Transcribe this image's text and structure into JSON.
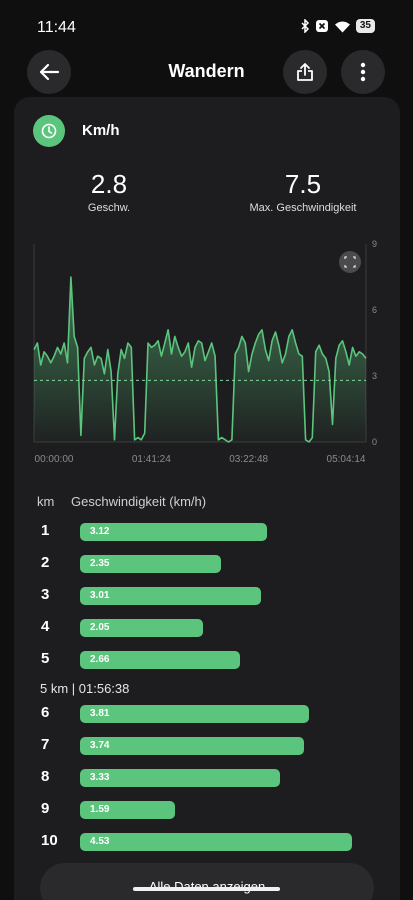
{
  "status": {
    "time": "11:44",
    "battery": "35"
  },
  "header": {
    "title": "Wandern"
  },
  "card": {
    "unit_label": "Km/h",
    "stats": {
      "avg_value": "2.8",
      "avg_label": "Geschw.",
      "max_value": "7.5",
      "max_label": "Max. Geschwindigkeit"
    }
  },
  "chart_data": {
    "type": "area",
    "title": "",
    "xlabel": "",
    "ylabel": "",
    "x_ticks": [
      "00:00:00",
      "01:41:24",
      "03:22:48",
      "05:04:14"
    ],
    "y_ticks": [
      "0",
      "3",
      "6",
      "9"
    ],
    "ylim": [
      0,
      9
    ],
    "average_line": 2.8,
    "series": [
      {
        "values": [
          4.2,
          4.5,
          3.5,
          4.1,
          3.9,
          3.6,
          3.9,
          4.3,
          4.0,
          4.5,
          3.6,
          7.5,
          4.8,
          4.3,
          0.3,
          3.8,
          4.1,
          4.3,
          3.5,
          3.9,
          3.8,
          3.1,
          4.2,
          3.2,
          0.1,
          3.1,
          4.2,
          3.8,
          4.5,
          4.3,
          0.1,
          0.2,
          0.1,
          0.4,
          4.5,
          4.3,
          4.4,
          4.6,
          3.9,
          4.5,
          5.1,
          4.0,
          4.8,
          4.3,
          3.9,
          4.1,
          4.5,
          3.4,
          4.3,
          4.6,
          4.5,
          3.7,
          4.1,
          4.5,
          3.9,
          0.1,
          0.2,
          0.1,
          0.0,
          0.1,
          4.0,
          4.3,
          4.8,
          4.5,
          3.2,
          4.0,
          4.5,
          4.9,
          5.1,
          4.2,
          3.7,
          4.6,
          5.0,
          4.4,
          3.6,
          4.0,
          4.8,
          5.1,
          4.5,
          4.0,
          3.9,
          0.1,
          0.0,
          0.2,
          4.1,
          4.4,
          4.0,
          3.8,
          3.2,
          0.8,
          3.8,
          4.4,
          4.6,
          4.1,
          3.5,
          4.3,
          3.9,
          4.1,
          4.0,
          3.8
        ]
      }
    ],
    "grid": false
  },
  "table": {
    "col_km": "km",
    "col_speed": "Geschwindigkeit (km/h)",
    "max_value": 5.0,
    "rows_a": [
      {
        "km": "1",
        "value": 3.12,
        "label": "3.12"
      },
      {
        "km": "2",
        "value": 2.35,
        "label": "2.35"
      },
      {
        "km": "3",
        "value": 3.01,
        "label": "3.01"
      },
      {
        "km": "4",
        "value": 2.05,
        "label": "2.05"
      },
      {
        "km": "5",
        "value": 2.66,
        "label": "2.66"
      }
    ],
    "split_label": "5 km | 01:56:38",
    "rows_b": [
      {
        "km": "6",
        "value": 3.81,
        "label": "3.81"
      },
      {
        "km": "7",
        "value": 3.74,
        "label": "3.74"
      },
      {
        "km": "8",
        "value": 3.33,
        "label": "3.33"
      },
      {
        "km": "9",
        "value": 1.59,
        "label": "1.59"
      },
      {
        "km": "10",
        "value": 4.53,
        "label": "4.53"
      }
    ]
  },
  "show_all_label": "Alle Daten anzeigen",
  "colors": {
    "accent": "#5cc57d",
    "card": "#1d1d1f",
    "background": "#0f0f10"
  }
}
